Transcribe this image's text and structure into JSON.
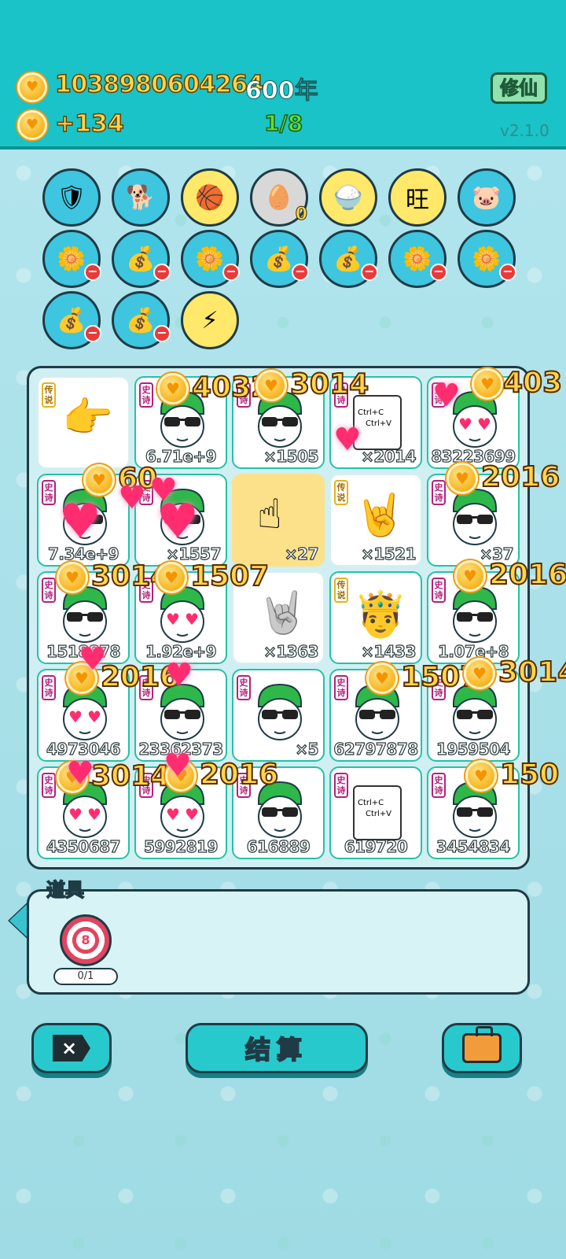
{
  "header": {
    "coins": "1038980604264",
    "year": "600年",
    "income": "+134",
    "progress": "1/8",
    "xiuxian_label": "修仙",
    "version": "v2.1.0"
  },
  "items_row1": [
    {
      "icon": "shield-wrench-icon",
      "glyph": "🛡"
    },
    {
      "icon": "dog-icon",
      "glyph": "🐕"
    },
    {
      "icon": "basketballs-icon",
      "glyph": "🏀"
    },
    {
      "icon": "egg-tray-icon",
      "glyph": "🥚",
      "count": "0"
    },
    {
      "icon": "rice-bowl-icon",
      "glyph": "🍚"
    },
    {
      "icon": "wang-text-icon",
      "glyph": "旺"
    },
    {
      "icon": "piggy-bank-icon",
      "glyph": "🐷"
    }
  ],
  "items_row2": [
    {
      "icon": "flower-pot-icon",
      "glyph": "🌼"
    },
    {
      "icon": "money-bag-icon",
      "glyph": "💰"
    },
    {
      "icon": "flower-pot-icon",
      "glyph": "🌼"
    },
    {
      "icon": "money-bag-icon",
      "glyph": "💰"
    },
    {
      "icon": "money-bag-icon",
      "glyph": "💰"
    },
    {
      "icon": "flower-pot-icon",
      "glyph": "🌼"
    },
    {
      "icon": "flower-pot-icon",
      "glyph": "🌼"
    }
  ],
  "items_row3": [
    {
      "icon": "money-bag-icon",
      "glyph": "💰"
    },
    {
      "icon": "money-bag-icon",
      "glyph": "💰"
    },
    {
      "icon": "lightning-icon",
      "glyph": "⚡"
    }
  ],
  "board": {
    "tag_legend": "传说",
    "tag_epic": "史诗",
    "cells": [
      "",
      "6.71e+9",
      "×1505",
      "×2014",
      "83223699",
      "7.34e+9",
      "×1557",
      "×27",
      "×1521",
      "×37",
      "1518878",
      "1.92e+9",
      "×1363",
      "×1433",
      "1.07e+8",
      "4973046",
      "23362373",
      "×5",
      "62797878",
      "1959504",
      "4350687",
      "5992819",
      "616889",
      "619720",
      "3454834"
    ],
    "ctrl_c": "Ctrl+C",
    "ctrl_v": "Ctrl+V"
  },
  "floats": [
    "4032",
    "3014",
    "403",
    "60",
    "2016",
    "3014",
    "1507",
    "2016",
    "2016",
    "1507",
    "3014",
    "3014",
    "2016",
    "150"
  ],
  "props": {
    "title": "道具",
    "target_value": "8",
    "target_count": "0/1"
  },
  "buttons": {
    "close_label": "×",
    "settle_label": "结算"
  },
  "colors": {
    "header_bg": "#19c3c7",
    "coin_text": "#ffd64a",
    "progress_green": "#5fe03c",
    "cell_border": "#25c1a8",
    "epic_tag": "#b3207e"
  }
}
